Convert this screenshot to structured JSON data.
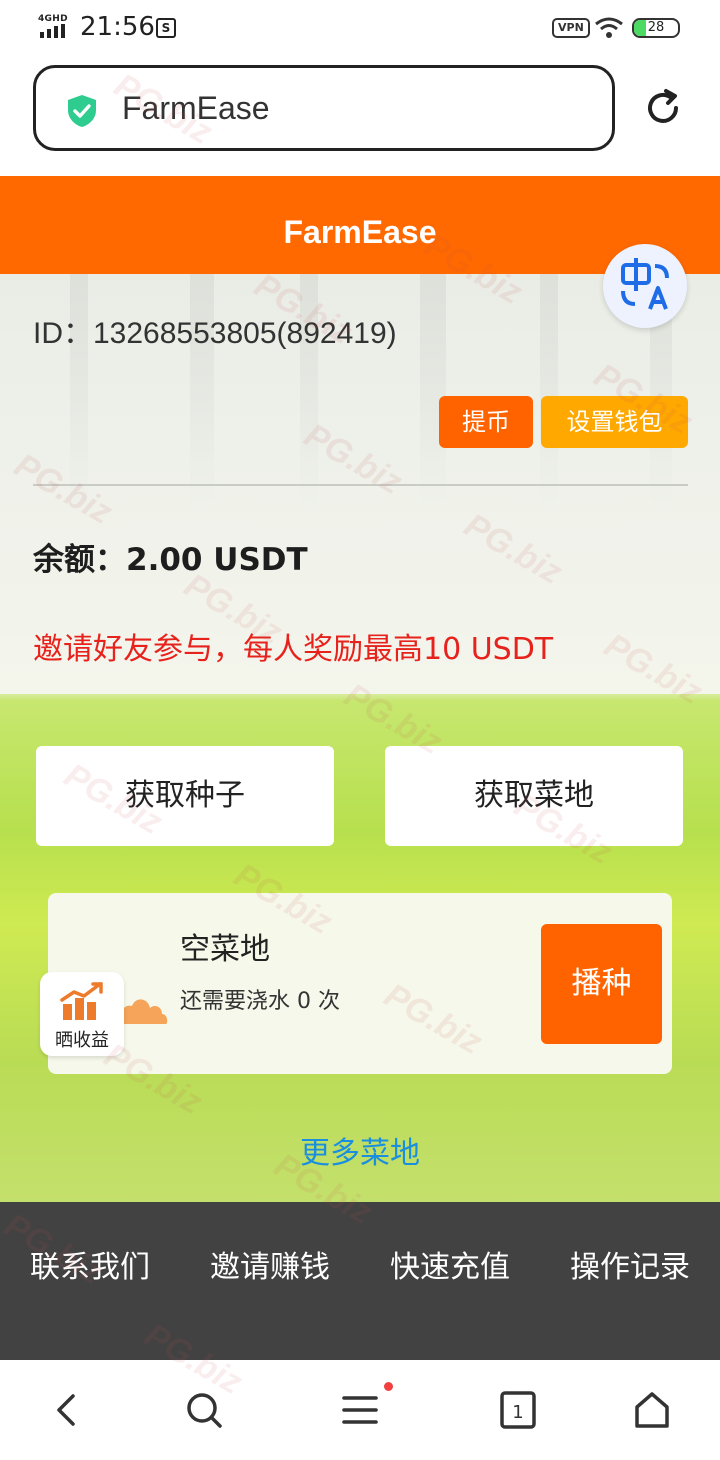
{
  "status_bar": {
    "network": "4GHD",
    "time": "21:56",
    "notification_icon": "sim-card-icon",
    "notification_glyph": "S",
    "vpn_label": "VPN",
    "battery_level": "28"
  },
  "browser": {
    "url_text": "FarmEase",
    "secure_icon": "shield-check-icon",
    "reload_icon": "reload-icon"
  },
  "header": {
    "title": "FarmEase",
    "translate_icon": "translate-icon",
    "translate_glyph_zh": "中",
    "translate_glyph_a": "A"
  },
  "account": {
    "id_text": "ID：13268553805(892419)",
    "withdraw_label": "提币",
    "wallet_label": "设置钱包",
    "balance_text": "余额：2.00 USDT",
    "invite_text": "邀请好友参与，每人奖励最高10 USDT"
  },
  "actions": {
    "get_seeds": "获取种子",
    "get_land": "获取菜地"
  },
  "plot": {
    "name": "空菜地",
    "water_text": "还需要浇水 0 次",
    "sow_label": "播种",
    "status_icon": "cloud-icon"
  },
  "share": {
    "label": "晒收益",
    "icon": "bar-chart-icon"
  },
  "more_land": "更多菜地",
  "footer_menu": [
    "联系我们",
    "邀请赚钱",
    "快速充值",
    "操作记录"
  ],
  "bottom_nav": {
    "tab_count": "1",
    "icons": [
      "back-icon",
      "search-icon",
      "menu-icon",
      "tabs-icon",
      "home-icon"
    ]
  },
  "watermark_text": "PG.biz",
  "colors": {
    "brand_orange": "#ff6900",
    "wallet_yellow": "#ffa800",
    "invite_red": "#e7221c",
    "link_blue": "#1a8fe0",
    "footer_gray": "#424242"
  }
}
